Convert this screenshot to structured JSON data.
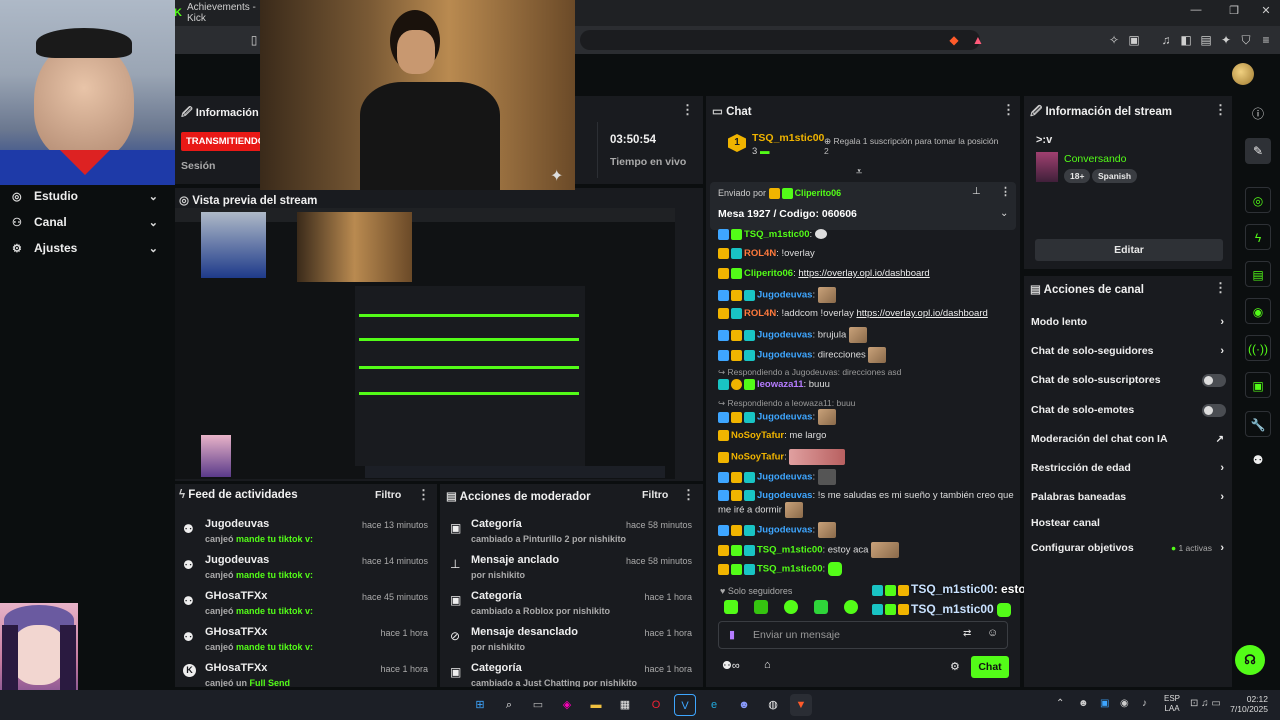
{
  "browser": {
    "tab_title": "Achievements - Kick",
    "window_controls": [
      "—",
      "❐",
      "✕"
    ]
  },
  "left_nav": {
    "items": [
      {
        "label": "Estudio",
        "icon": "studio-icon"
      },
      {
        "label": "Canal",
        "icon": "channel-icon"
      },
      {
        "label": "Ajustes",
        "icon": "gear-icon"
      }
    ]
  },
  "stream_info_left": {
    "title": "Información de",
    "status_badge": "TRANSMITIENDO",
    "session_label": "Sesión",
    "time_value": "03:50:54",
    "time_label": "Tiempo en vivo"
  },
  "preview": {
    "title": "Vista previa del stream"
  },
  "feed": {
    "title": "Feed de actividades",
    "filter": "Filtro",
    "items": [
      {
        "name": "Jugodeuvas",
        "sub_prefix": "canjeó",
        "sub_bold": "mande tu tiktok v:",
        "time": "hace 13 minutos"
      },
      {
        "name": "Jugodeuvas",
        "sub_prefix": "canjeó",
        "sub_bold": "mande tu tiktok v:",
        "time": "hace 14 minutos"
      },
      {
        "name": "GHosaTFXx",
        "sub_prefix": "canjeó",
        "sub_bold": "mande tu tiktok v:",
        "time": "hace 45 minutos"
      },
      {
        "name": "GHosaTFXx",
        "sub_prefix": "canjeó",
        "sub_bold": "mande tu tiktok v:",
        "time": "hace 1 hora"
      },
      {
        "name": "GHosaTFXx",
        "sub_prefix": "canjeó un",
        "sub_bold": "Full Send",
        "time": "hace 1 hora"
      }
    ]
  },
  "mod_actions": {
    "title": "Acciones de moderador",
    "filter": "Filtro",
    "items": [
      {
        "title": "Categoría",
        "line": "cambiado a Pinturillo 2 por nishikito",
        "time": "hace 58 minutos"
      },
      {
        "title": "Mensaje anclado",
        "line": "por nishikito",
        "time": "hace 58 minutos"
      },
      {
        "title": "Categoría",
        "line": "cambiado a Roblox por nishikito",
        "time": "hace 1 hora"
      },
      {
        "title": "Mensaje desanclado",
        "line": "por nishikito",
        "time": "hace 1 hora"
      },
      {
        "title": "Categoría",
        "line": "cambiado a Just Chatting por nishikito",
        "time": "hace 1 hora"
      }
    ]
  },
  "chat": {
    "title": "Chat",
    "top_gifter": {
      "rank": "1",
      "name": "TSQ_m1stic00",
      "count": "3",
      "gift_hint": "Regala 1 suscripción para tomar la posición 2"
    },
    "pinned": {
      "sent_by_label": "Enviado por",
      "sender": "Cliperito06",
      "text": "Mesa 1927 / Codigo: 060606"
    },
    "messages": [
      {
        "user": "TSQ_m1stic00",
        "color": "#53fc18",
        "text": "",
        "badges": [
          "teal",
          "green"
        ]
      },
      {
        "user": "ROL4N",
        "color": "#ff7a3d",
        "text": "!overlay",
        "badges": [
          "gold",
          "teal"
        ]
      },
      {
        "user": "Cliperito06",
        "color": "#53fc18",
        "text": "",
        "link": "https://overlay.opl.io/dashboard",
        "badges": [
          "gold",
          "green"
        ]
      },
      {
        "user": "Jugodeuvas",
        "color": "#3ea6ff",
        "text": "",
        "emote": true,
        "badges": [
          "blue",
          "gold",
          "teal"
        ]
      },
      {
        "user": "ROL4N",
        "color": "#ff7a3d",
        "text": "!addcom !overlay",
        "link": "https://overlay.opl.io/dashboard",
        "badges": [
          "gold",
          "teal"
        ]
      },
      {
        "user": "Jugodeuvas",
        "color": "#3ea6ff",
        "text": "brujula",
        "emote": true,
        "badges": [
          "blue",
          "gold",
          "teal"
        ]
      },
      {
        "user": "Jugodeuvas",
        "color": "#3ea6ff",
        "text": "direcciones",
        "emote": true,
        "badges": [
          "blue",
          "gold",
          "teal"
        ]
      },
      {
        "reply": "Respondiendo a Jugodeuvas: direcciones asd",
        "user": "leowaza11",
        "color": "#b57cff",
        "text": "buuu",
        "badges": [
          "teal",
          "gold"
        ]
      },
      {
        "reply": "Respondiendo a leowaza11: buuu",
        "user": "Jugodeuvas",
        "color": "#3ea6ff",
        "text": "",
        "emote": true,
        "badges": [
          "blue",
          "gold",
          "teal"
        ]
      },
      {
        "user": "NoSoyTafur",
        "color": "#f0b400",
        "text": "me largo",
        "badges": [
          "gold"
        ]
      },
      {
        "user": "NoSoyTafur",
        "color": "#f0b400",
        "text": "",
        "emote": true,
        "badges": [
          "gold"
        ]
      },
      {
        "user": "Jugodeuvas",
        "color": "#3ea6ff",
        "text": "",
        "emote": true,
        "badges": [
          "blue",
          "gold",
          "teal"
        ]
      },
      {
        "user": "Jugodeuvas",
        "color": "#3ea6ff",
        "text": "!s me saludas es mi sueño y también creo que me iré a dormir",
        "emote": true,
        "badges": [
          "blue",
          "gold",
          "teal"
        ]
      },
      {
        "user": "Jugodeuvas",
        "color": "#3ea6ff",
        "text": "",
        "emote": true,
        "badges": [
          "blue",
          "gold",
          "teal"
        ]
      },
      {
        "user": "TSQ_m1stic00",
        "color": "#53fc18",
        "text": "estoy aca",
        "emote": true,
        "badges": [
          "gold",
          "green",
          "teal"
        ]
      },
      {
        "user": "TSQ_m1stic00",
        "color": "#53fc18",
        "text": "",
        "emote": true,
        "badges": [
          "gold",
          "green",
          "teal"
        ]
      }
    ],
    "mode_label": "Solo seguidores",
    "input_placeholder": "Enviar un mensaje",
    "send_label": "Chat",
    "overlay_line1_user": "TSQ_m1stic00",
    "overlay_line1_text": ": estoy aca",
    "overlay_line2_user": "TSQ_m1stic00"
  },
  "stream_info_right": {
    "title": "Información del stream",
    "stream_title": ">:v",
    "category": "Conversando",
    "tags": [
      "18+",
      "Spanish"
    ],
    "edit_label": "Editar"
  },
  "channel_actions": {
    "title": "Acciones de canal",
    "items": [
      {
        "label": "Modo lento",
        "control": "chevron"
      },
      {
        "label": "Chat de solo-seguidores",
        "control": "chevron"
      },
      {
        "label": "Chat de solo-suscriptores",
        "control": "toggle"
      },
      {
        "label": "Chat de solo-emotes",
        "control": "toggle"
      },
      {
        "label": "Moderación del chat con IA",
        "control": "external"
      },
      {
        "label": "Restricción de edad",
        "control": "chevron"
      },
      {
        "label": "Palabras baneadas",
        "control": "chevron"
      },
      {
        "label": "Hostear canal",
        "control": "none"
      },
      {
        "label": "Configurar objetivos",
        "control": "chevron",
        "extra": "1 activas"
      }
    ]
  },
  "taskbar": {
    "lang_line1": "ESP",
    "lang_line2": "LAA",
    "time": "02:12",
    "date": "7/10/2025"
  },
  "colors": {
    "accent": "#53fc18",
    "live_badge": "#e91916",
    "panel": "#191b1f",
    "background": "#0b0e0f"
  }
}
